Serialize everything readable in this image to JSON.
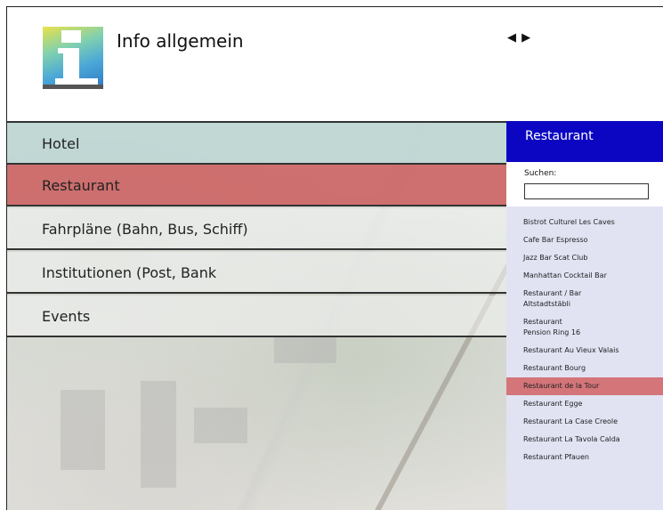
{
  "header": {
    "title": "Info allgemein",
    "prev_arrow": "◀",
    "next_arrow": "▶"
  },
  "menu": [
    {
      "label": "Hotel"
    },
    {
      "label": "Restaurant"
    },
    {
      "label": "Fahrpläne (Bahn, Bus, Schiff)"
    },
    {
      "label": "Institutionen (Post, Bank"
    },
    {
      "label": "Events"
    }
  ],
  "side": {
    "title": "Restaurant",
    "search_label": "Suchen:",
    "search_value": "",
    "items": [
      "Bistrot Culturel Les Caves",
      "Cafe Bar Espresso",
      "Jazz Bar Scat Club",
      "Manhattan Cocktail Bar",
      "Restaurant / Bar\nAltstadtstäbli",
      "Restaurant\nPension Ring 16",
      "Restaurant Au Vieux Valais",
      "Restaurant Bourg",
      "Restaurant de la Tour",
      "Restaurant Egge",
      "Restaurant La Case Creole",
      "Restaurant La Tavola Calda",
      "Restaurant Pfauen"
    ],
    "active_index": 8
  },
  "colors": {
    "hotel_bg": "#bcd6d4",
    "restaurant_bg": "#cc6060",
    "side_header_bg": "#0c06c2",
    "side_bg": "#e1e3f3",
    "active_item_bg": "#d4757a"
  },
  "icons": {
    "logo": "info-i-icon",
    "prev": "left-triangle-icon",
    "next": "right-triangle-icon"
  }
}
